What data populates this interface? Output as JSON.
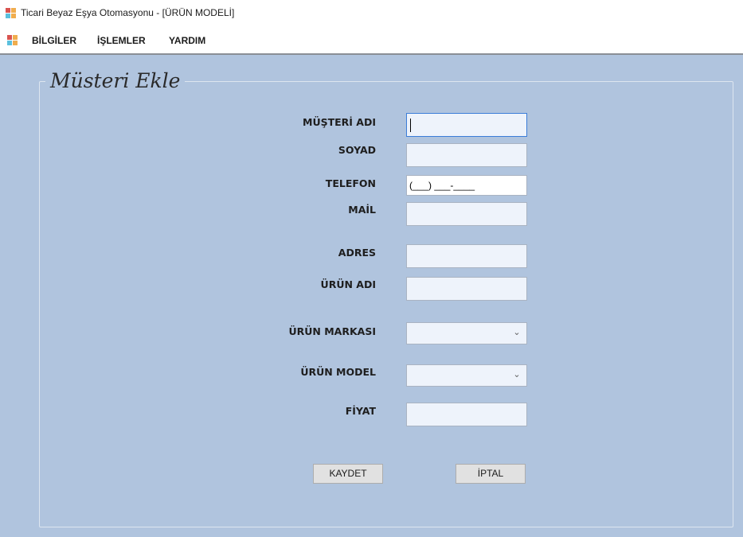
{
  "window": {
    "title": "Ticari Beyaz Eşya Otomasyonu - [ÜRÜN MODELİ]",
    "icon": "app-window-icon"
  },
  "menu": {
    "items": [
      {
        "label": "BİLGİLER"
      },
      {
        "label": "İŞLEMLER"
      },
      {
        "label": "YARDIM"
      }
    ]
  },
  "form": {
    "title": "Müsteri Ekle",
    "labels": {
      "customer_name": "MÜŞTERİ ADI",
      "surname": "SOYAD",
      "phone": "TELEFON",
      "mail": "MAİL",
      "address": "ADRES",
      "product_name": "ÜRÜN ADI",
      "product_brand": "ÜRÜN MARKASI",
      "product_model": "ÜRÜN MODEL",
      "price": "FİYAT"
    },
    "values": {
      "customer_name": "",
      "surname": "",
      "phone_mask": "(___) ___-____",
      "mail": "",
      "address": "",
      "product_name": "",
      "product_brand": "",
      "product_model": "",
      "price": ""
    },
    "buttons": {
      "save": "KAYDET",
      "cancel": "İPTAL"
    }
  },
  "colors": {
    "client_background": "#b0c4de",
    "textbox_background": "#eef3fb",
    "focus_border": "#3b7dd8"
  }
}
